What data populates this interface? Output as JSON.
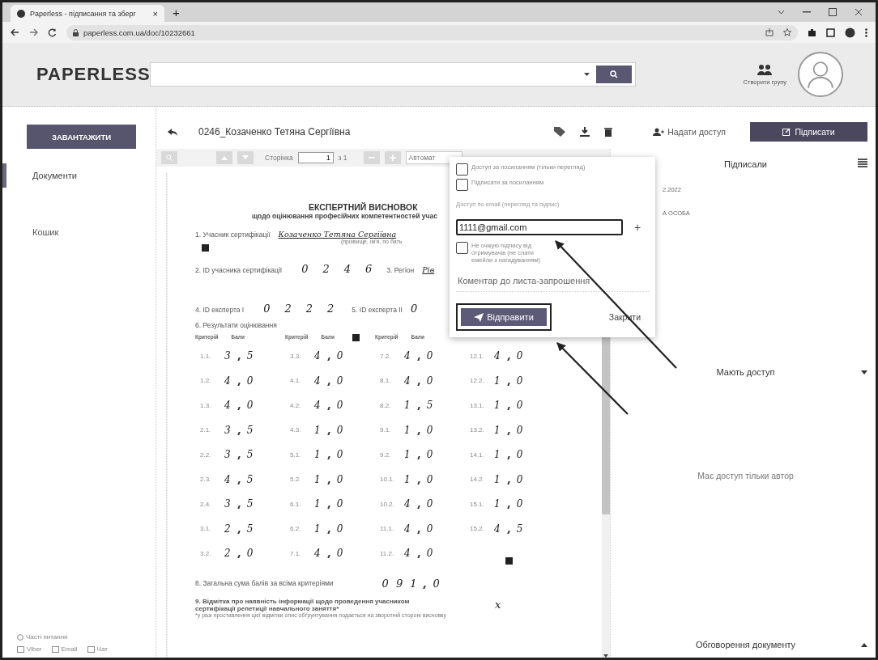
{
  "browser": {
    "tab_title": "Paperless - підписання та зберг",
    "tab_close": "×",
    "new_tab": "+",
    "url": "paperless.com.ua/doc/10232661"
  },
  "header": {
    "logo": "PAPERLESS",
    "create_group": "Створити групу"
  },
  "sidebar": {
    "upload": "ЗАВАНТАЖИТИ",
    "items": [
      {
        "label": "Документи",
        "selected": true
      },
      {
        "label": "Кошик",
        "selected": false
      }
    ],
    "faq": "Часті питання",
    "contacts": [
      "Viber",
      "Email",
      "Чат"
    ]
  },
  "document_bar": {
    "title": "0246_Козаченко Тетяна Сергіївна",
    "share": "Надати доступ",
    "sign": "Підписати"
  },
  "viewer_toolbar": {
    "page_label": "Сторінка",
    "page": "1",
    "of": "з 1",
    "zoom": "Автомат"
  },
  "document": {
    "title": "ЕКСПЕРТНИЙ ВИСНОВОК",
    "subtitle": "щодо оцінювання професійних компетентностей учас",
    "participant_label": "1. Учасник сертифікації",
    "participant_name": "Козаченко Тетяна Сергіївна",
    "participant_hint": "(прізвище, ім'я, по бать",
    "participant_id_label": "2. ID учасника сертифікації",
    "participant_id": [
      "0",
      "2",
      "4",
      "6"
    ],
    "region_label": "3. Регіон",
    "region": "Рів",
    "expert1_label": "4. ID експерта I",
    "expert1_id": [
      "0",
      "2",
      "2",
      "2"
    ],
    "expert2_label": "5. ID експерта II",
    "expert2_id": [
      "0"
    ],
    "results_label": "6. Результати оцінювання",
    "score_columns": [
      {
        "header": [
          "Критерій",
          "Бали"
        ],
        "rows": [
          {
            "criterion": "1.1.",
            "whole": "3",
            "fraction": "5"
          },
          {
            "criterion": "1.2.",
            "whole": "4",
            "fraction": "0"
          },
          {
            "criterion": "1.3.",
            "whole": "4",
            "fraction": "0"
          },
          {
            "criterion": "2.1.",
            "whole": "3",
            "fraction": "5"
          },
          {
            "criterion": "2.2.",
            "whole": "3",
            "fraction": "5"
          },
          {
            "criterion": "2.3.",
            "whole": "4",
            "fraction": "5"
          },
          {
            "criterion": "2.4.",
            "whole": "3",
            "fraction": "5"
          },
          {
            "criterion": "3.1.",
            "whole": "2",
            "fraction": "5"
          },
          {
            "criterion": "3.2.",
            "whole": "2",
            "fraction": "0"
          }
        ]
      },
      {
        "header": [
          "Критерій",
          "Бали"
        ],
        "rows": [
          {
            "criterion": "3.3.",
            "whole": "4",
            "fraction": "0"
          },
          {
            "criterion": "4.1.",
            "whole": "4",
            "fraction": "0"
          },
          {
            "criterion": "4.2.",
            "whole": "4",
            "fraction": "0"
          },
          {
            "criterion": "4.3.",
            "whole": "1",
            "fraction": "0"
          },
          {
            "criterion": "5.1.",
            "whole": "1",
            "fraction": "0"
          },
          {
            "criterion": "5.2.",
            "whole": "1",
            "fraction": "0"
          },
          {
            "criterion": "6.1.",
            "whole": "1",
            "fraction": "0"
          },
          {
            "criterion": "6.2.",
            "whole": "1",
            "fraction": "0"
          },
          {
            "criterion": "7.1.",
            "whole": "4",
            "fraction": "0"
          }
        ]
      },
      {
        "header": [
          "Критерій",
          "Бали"
        ],
        "rows": [
          {
            "criterion": "7.2.",
            "whole": "4",
            "fraction": "0"
          },
          {
            "criterion": "8.1.",
            "whole": "4",
            "fraction": "0"
          },
          {
            "criterion": "8.2.",
            "whole": "1",
            "fraction": "5"
          },
          {
            "criterion": "9.1.",
            "whole": "1",
            "fraction": "0"
          },
          {
            "criterion": "9.2.",
            "whole": "1",
            "fraction": "0"
          },
          {
            "criterion": "10.1.",
            "whole": "1",
            "fraction": "0"
          },
          {
            "criterion": "10.2.",
            "whole": "4",
            "fraction": "0"
          },
          {
            "criterion": "11.1.",
            "whole": "4",
            "fraction": "0"
          },
          {
            "criterion": "11.2.",
            "whole": "4",
            "fraction": "0"
          }
        ]
      },
      {
        "rows": [
          {
            "criterion": "12.1.",
            "whole": "4",
            "fraction": "0"
          },
          {
            "criterion": "12.2.",
            "whole": "1",
            "fraction": "0"
          },
          {
            "criterion": "13.1.",
            "whole": "1",
            "fraction": "0"
          },
          {
            "criterion": "13.2.",
            "whole": "1",
            "fraction": "0"
          },
          {
            "criterion": "14.1.",
            "whole": "1",
            "fraction": "0"
          },
          {
            "criterion": "14.2.",
            "whole": "1",
            "fraction": "0"
          },
          {
            "criterion": "15.1.",
            "whole": "1",
            "fraction": "0"
          },
          {
            "criterion": "15.2.",
            "whole": "4",
            "fraction": "5"
          }
        ]
      }
    ],
    "total_label": "8. Загальна сума балів за всіма критеріями",
    "total_digits": [
      "0",
      "9",
      "1",
      "0"
    ],
    "note_label": "9. Відмітка про наявність інформації щодо проведення учасником сертифікації репетиції навчального заняття*",
    "note_mark": "x",
    "footnote": "*у разі проставлення цієї відмітки опис обґрунтування подається на зворотній стороні висновку"
  },
  "share_popup": {
    "options": [
      {
        "label": "Доступ за посиланням (тільки перегляд)",
        "checked": false
      },
      {
        "label": "Підписати за посиланням",
        "checked": false
      }
    ],
    "email_label": "Доступ по email (перегляд та підпис)",
    "email": "1111@gmail.com",
    "add": "+",
    "no_wait": {
      "label": "Не очікую підпису від отримувачів (не слати емейли з нагадуванням)",
      "checked": false
    },
    "comment_placeholder": "Коментар до листа-запрошення",
    "send": "Відправити",
    "close": "Закрити"
  },
  "right_panel": {
    "signed_title": "Підписали",
    "signed": [
      {
        "date": "2.2022",
        "name": "А ОСОБА"
      }
    ],
    "access_title": "Мають доступ",
    "access_text": "Має доступ тільки автор",
    "discussion_title": "Обговорення документу"
  }
}
